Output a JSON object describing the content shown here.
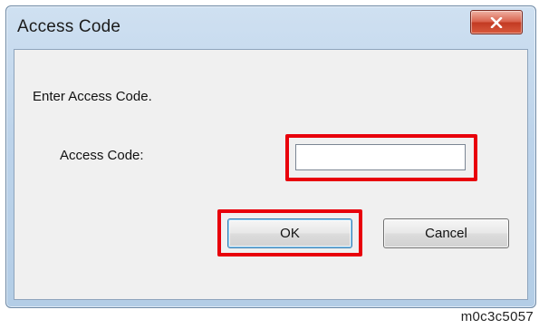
{
  "window": {
    "title": "Access Code",
    "close_icon": "close-icon"
  },
  "dialog": {
    "prompt": "Enter Access Code.",
    "field_label": "Access Code:",
    "field_value": "",
    "ok_label": "OK",
    "cancel_label": "Cancel"
  },
  "figure_id": "m0c3c5057",
  "colors": {
    "highlight": "#e8000b",
    "titlebar": "#bcd3ea",
    "close_button": "#c23a23"
  }
}
